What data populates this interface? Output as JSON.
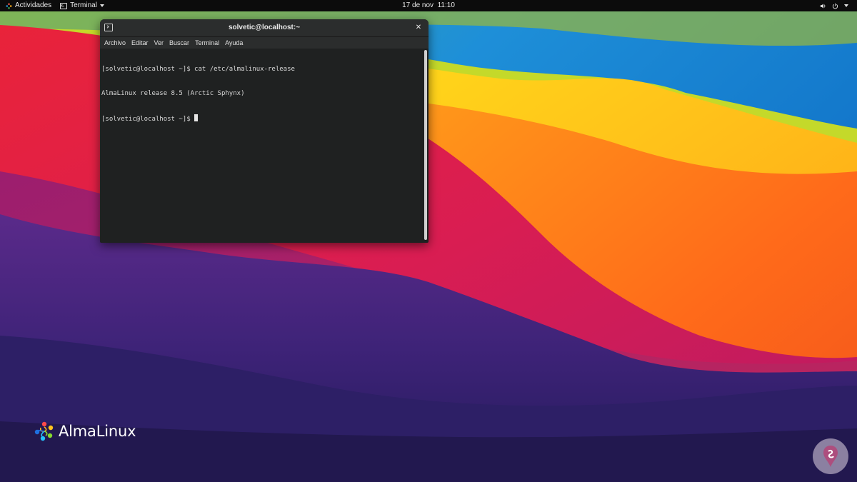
{
  "topbar": {
    "activities_label": "Actividades",
    "app_menu_label": "Terminal",
    "datetime": "17 de nov  11:10"
  },
  "terminal": {
    "title": "solvetic@localhost:~",
    "menu": [
      "Archivo",
      "Editar",
      "Ver",
      "Buscar",
      "Terminal",
      "Ayuda"
    ],
    "lines": [
      "[solvetic@localhost ~]$ cat /etc/almalinux-release",
      "AlmaLinux release 8.5 (Arctic Sphynx)",
      "[solvetic@localhost ~]$ "
    ]
  },
  "desktop": {
    "logo_text": "AlmaLinux"
  },
  "icons": {
    "activities": "activities-icon",
    "app_menu": "terminal-icon",
    "volume": "volume-icon",
    "power": "power-icon",
    "window": "terminal-window-icon",
    "close": "close-icon",
    "logo": "almalinux-logo-icon",
    "watermark": "solvetic-watermark-icon"
  }
}
